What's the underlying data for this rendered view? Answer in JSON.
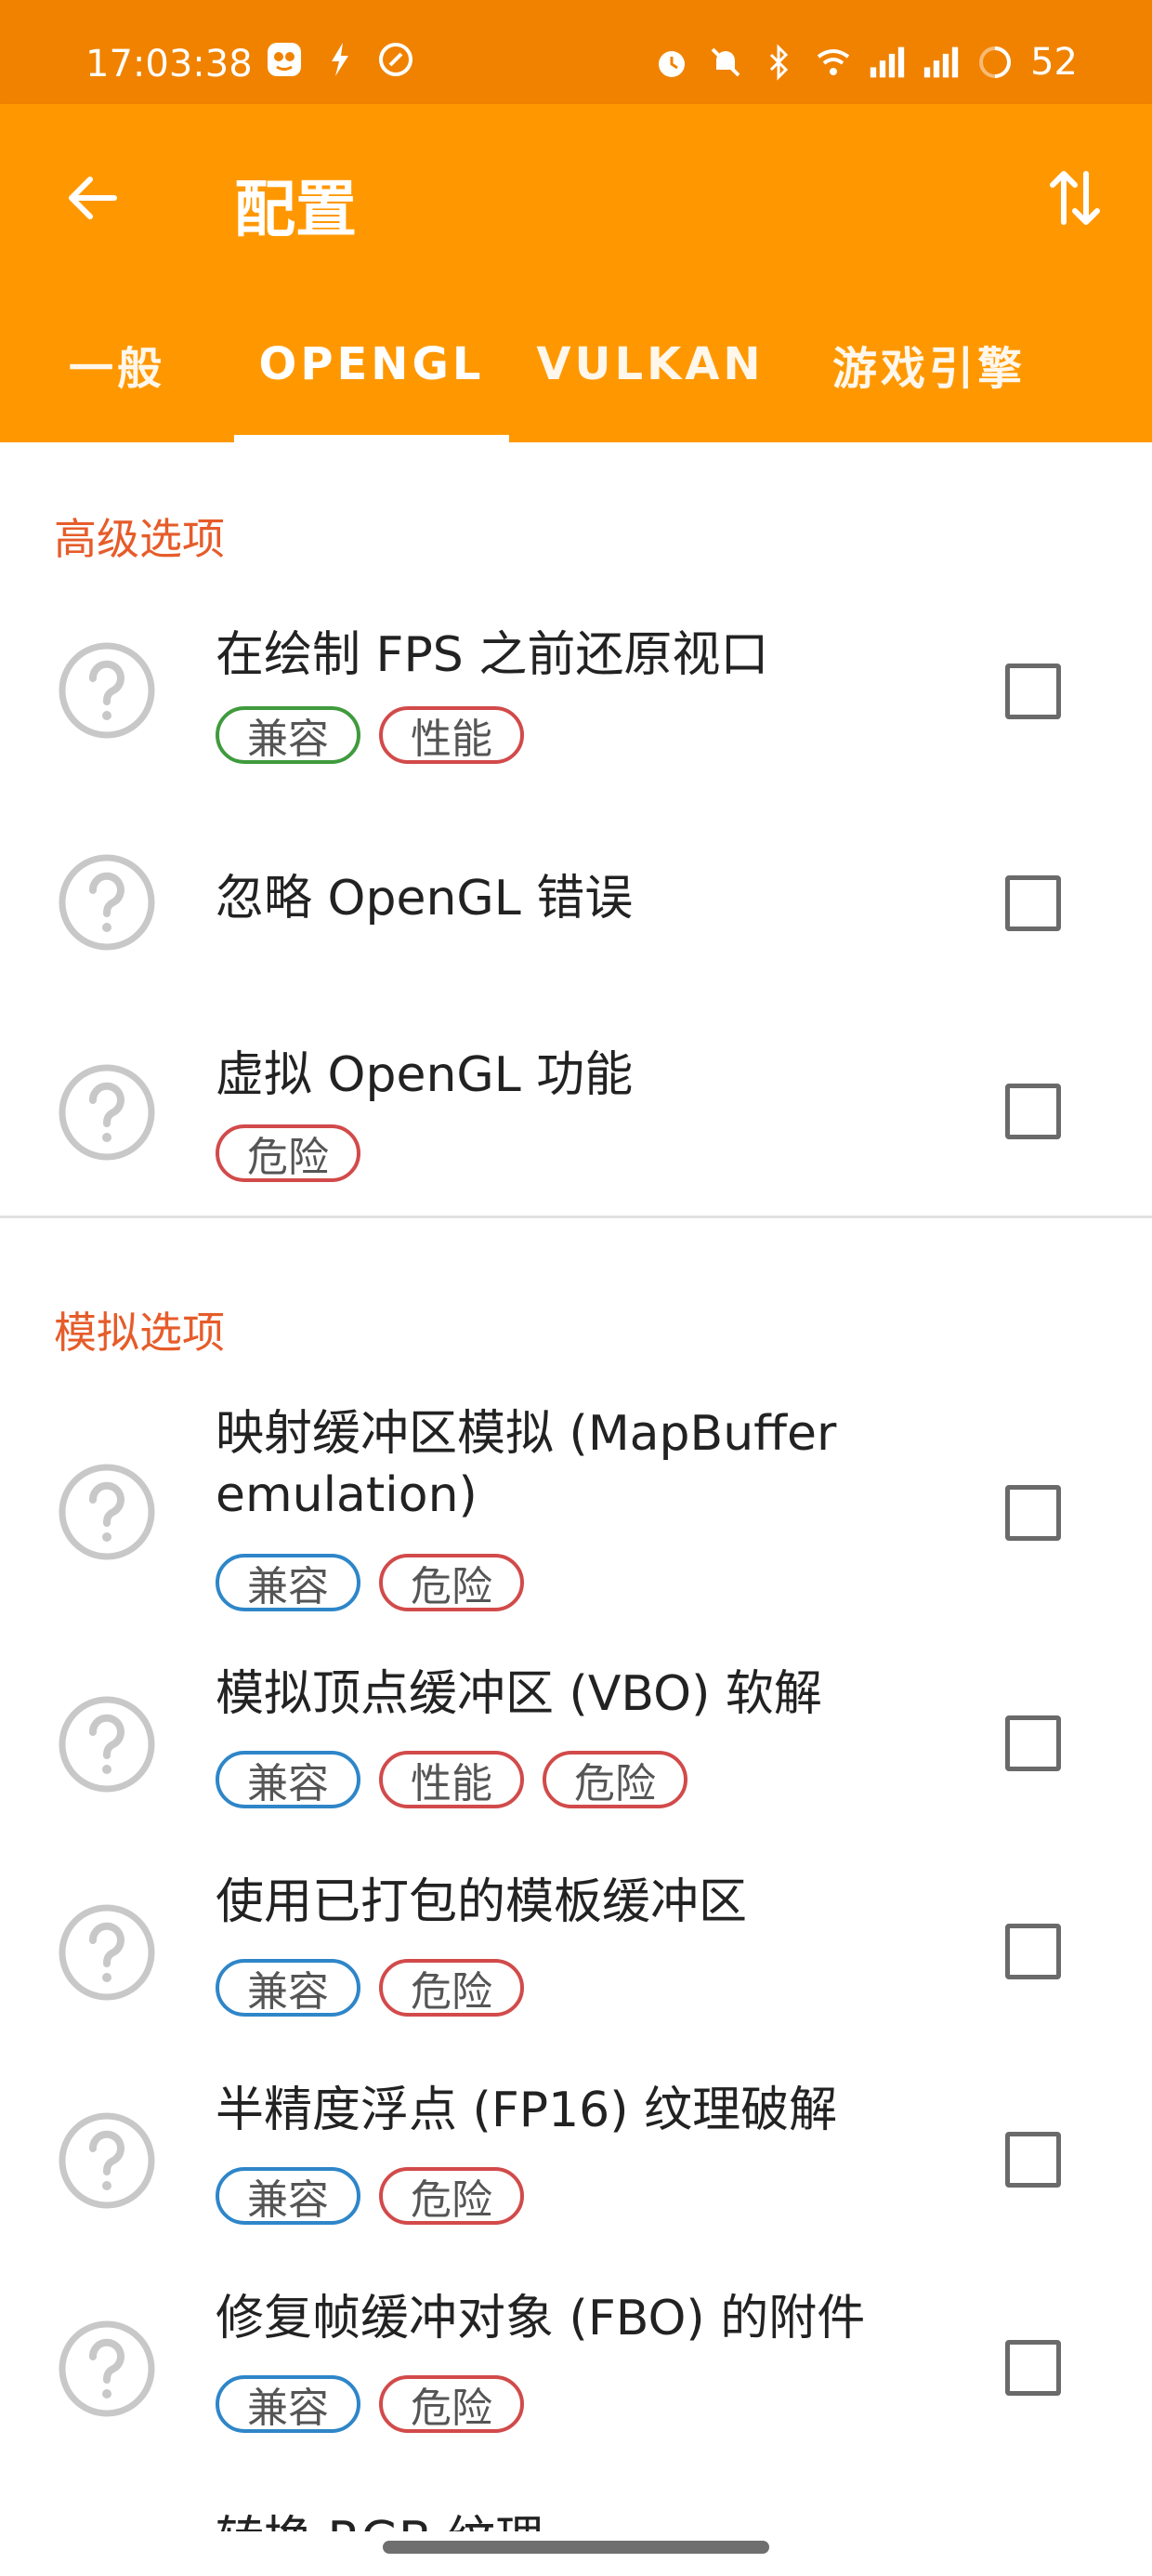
{
  "status_bar": {
    "time": "17:03:38",
    "battery": "52",
    "icons_left": [
      "app-notification-icon",
      "bolt-icon",
      "compass-icon"
    ],
    "icons_right": [
      "alarm-icon",
      "muted-bell-icon",
      "bluetooth-icon",
      "wifi-icon",
      "signal-icon",
      "signal-icon",
      "battery-ring-icon"
    ]
  },
  "appbar": {
    "title": "配置",
    "back_icon": "arrow-left-icon",
    "sort_icon": "sort-arrows-icon"
  },
  "tabs": [
    {
      "label": "一般",
      "active": false
    },
    {
      "label": "OPENGL",
      "active": true
    },
    {
      "label": "VULKAN",
      "active": false
    },
    {
      "label": "游戏引擎",
      "active": false
    }
  ],
  "sections": [
    {
      "header": "高级选项",
      "items": [
        {
          "title": "在绘制 FPS 之前还原视口",
          "badges": [
            "兼容",
            "性能"
          ],
          "checked": false
        },
        {
          "title": "忽略 OpenGL 错误",
          "badges": [],
          "checked": false
        },
        {
          "title": "虚拟 OpenGL 功能",
          "badges": [
            "危险"
          ],
          "checked": false
        }
      ]
    },
    {
      "header": "模拟选项",
      "items": [
        {
          "title": "映射缓冲区模拟 (MapBuffer emulation)",
          "badges": [
            "兼容",
            "危险"
          ],
          "checked": false
        },
        {
          "title": "模拟顶点缓冲区 (VBO) 软解",
          "badges": [
            "兼容",
            "性能",
            "危险"
          ],
          "checked": false
        },
        {
          "title": "使用已打包的模板缓冲区",
          "badges": [
            "兼容",
            "危险"
          ],
          "checked": false
        },
        {
          "title": "半精度浮点 (FP16) 纹理破解",
          "badges": [
            "兼容",
            "危险"
          ],
          "checked": false
        },
        {
          "title": "修复帧缓冲对象 (FBO) 的附件",
          "badges": [
            "兼容",
            "危险"
          ],
          "checked": false
        },
        {
          "title": "转换 RGB 纹理",
          "badges": [],
          "checked": false
        }
      ]
    }
  ],
  "colors": {
    "status_bar": "#f08200",
    "appbar": "#ff9800",
    "section_header": "#e65c2a",
    "badge_green": "#3f9b3d",
    "badge_red": "#d24a4a",
    "badge_blue": "#2e86c9"
  }
}
